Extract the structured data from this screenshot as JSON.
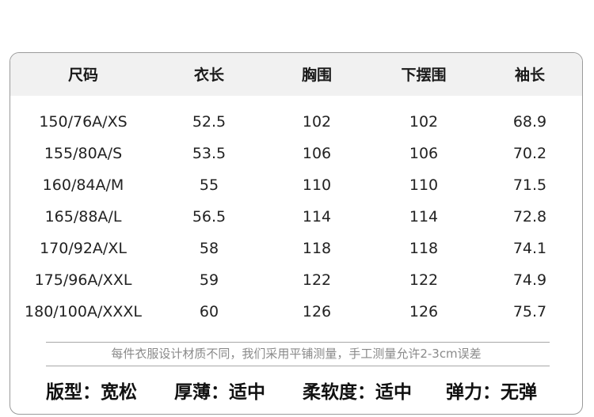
{
  "table": {
    "headers": [
      "尺码",
      "衣长",
      "胸围",
      "下摆围",
      "袖长"
    ],
    "rows": [
      [
        "150/76A/XS",
        "52.5",
        "102",
        "102",
        "68.9"
      ],
      [
        "155/80A/S",
        "53.5",
        "106",
        "106",
        "70.2"
      ],
      [
        "160/84A/M",
        "55",
        "110",
        "110",
        "71.5"
      ],
      [
        "165/88A/L",
        "56.5",
        "114",
        "114",
        "72.8"
      ],
      [
        "170/92A/XL",
        "58",
        "118",
        "118",
        "74.1"
      ],
      [
        "175/96A/XXL",
        "59",
        "122",
        "122",
        "74.9"
      ],
      [
        "180/100A/XXXL",
        "60",
        "126",
        "126",
        "75.7"
      ]
    ]
  },
  "note": "每件衣服设计材质不同，我们采用平铺测量，手工测量允许2-3cm误差",
  "attributes": [
    "版型：宽松",
    "厚薄：适中",
    "柔软度：适中",
    "弹力：无弹"
  ]
}
